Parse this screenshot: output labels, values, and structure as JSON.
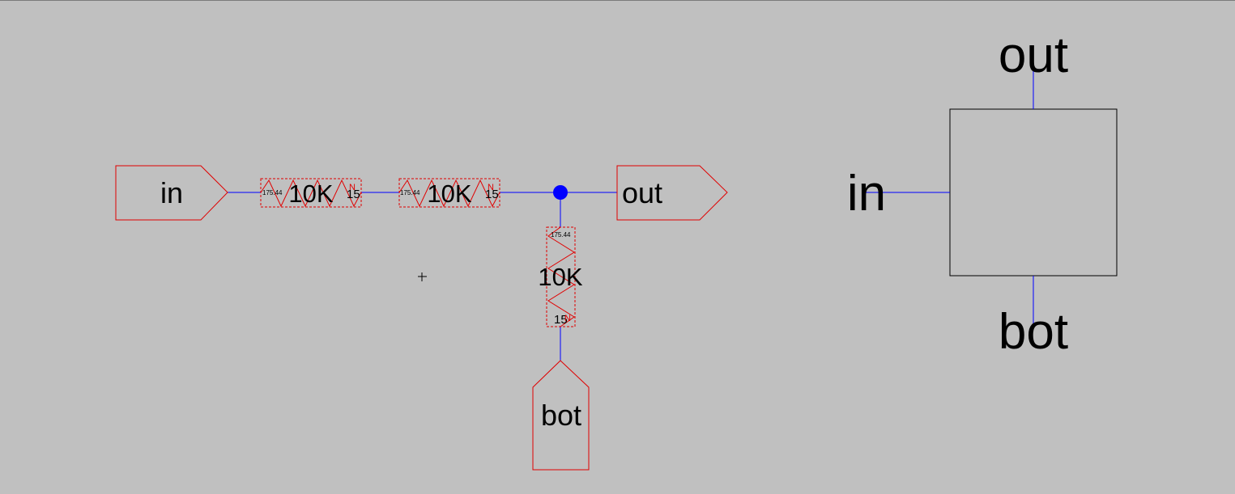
{
  "schematic": {
    "pins": [
      {
        "name": "in"
      },
      {
        "name": "out"
      },
      {
        "name": "bot"
      }
    ],
    "resistors": [
      {
        "value": "10K",
        "param_a": "175.44",
        "param_b": "15",
        "mark": "N"
      },
      {
        "value": "10K",
        "param_a": "175.44",
        "param_b": "15",
        "mark": "N"
      },
      {
        "value": "10K",
        "param_a": "175.44",
        "param_b": "15",
        "mark": "N"
      }
    ]
  },
  "symbol": {
    "pins": [
      {
        "name": "out"
      },
      {
        "name": "in"
      },
      {
        "name": "bot"
      }
    ]
  },
  "colors": {
    "background": "#c0c0c0",
    "wire": "#0000ff",
    "component": "#e00000",
    "junction": "#0000ff",
    "symbol_outline": "#000000"
  }
}
